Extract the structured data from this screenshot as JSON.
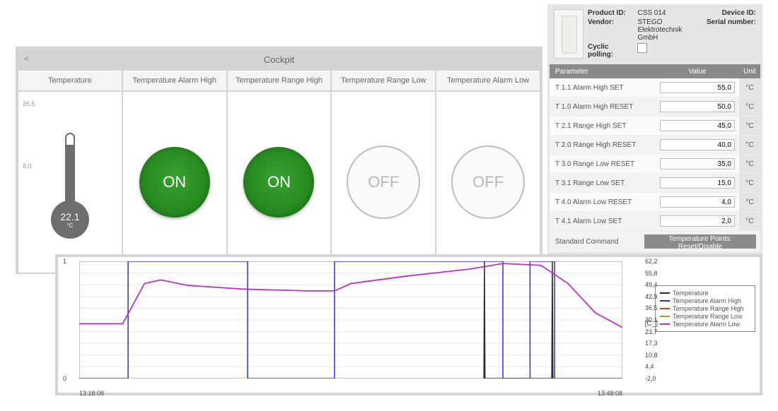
{
  "cockpit": {
    "title": "Cockpit",
    "back_label": "<",
    "columns": [
      {
        "header": "Temperature"
      },
      {
        "header": "Temperature Alarm High"
      },
      {
        "header": "Temperature Range High"
      },
      {
        "header": "Temperature Range Low"
      },
      {
        "header": "Temperature Alarm Low"
      }
    ],
    "thermometer": {
      "scale_top": "26.5",
      "scale_bottom": "8.0",
      "value": "22.1",
      "unit": "°C"
    },
    "indicators": {
      "on_label": "ON",
      "off_label": "OFF",
      "states": [
        "ON",
        "ON",
        "OFF",
        "OFF"
      ]
    }
  },
  "device": {
    "labels": {
      "product_id": "Product ID:",
      "vendor": "Vendor:",
      "cyclic_polling": "Cyclic polling:",
      "device_id": "Device ID:",
      "serial_number": "Serial number:"
    },
    "values": {
      "product_id": "CSS 014",
      "vendor": "STEGO Elektrotechnik GmbH",
      "device_id": "",
      "serial_number": ""
    },
    "cyclic_polling_checked": false,
    "table_head": {
      "parameter": "Parameter",
      "value": "Value",
      "unit": "Unit"
    },
    "rows": [
      {
        "param": "T 1.1 Alarm High SET",
        "value": "55,0",
        "unit": "°C"
      },
      {
        "param": "T 1.0 Alarm High RESET",
        "value": "50,0",
        "unit": "°C"
      },
      {
        "param": "T 2.1 Range High SET",
        "value": "45,0",
        "unit": "°C"
      },
      {
        "param": "T 2.0 Range High RESET",
        "value": "40,0",
        "unit": "°C"
      },
      {
        "param": "T 3.0 Range Low RESET",
        "value": "35,0",
        "unit": "°C"
      },
      {
        "param": "T 3.1 Range Low SET",
        "value": "15,0",
        "unit": "°C"
      },
      {
        "param": "T 4.0 Alarm Low RESET",
        "value": "4,0",
        "unit": "°C"
      },
      {
        "param": "T 4.1 Alarm Low SET",
        "value": "2,0",
        "unit": "°C"
      }
    ],
    "command_row": {
      "label": "Standard Command",
      "button": "Temperature Points: Reset/Disable"
    }
  },
  "chart_data": {
    "type": "line",
    "x_range_labels": [
      "13:18:08",
      "13:48:08"
    ],
    "left_axis": {
      "ticks": [
        "0",
        "1"
      ],
      "label": ""
    },
    "right_axis": {
      "ticks": [
        "-2,0",
        "4,4",
        "10,8",
        "17,3",
        "23,7",
        "30,1",
        "36,5",
        "42,9",
        "49,4",
        "55,8",
        "62,2"
      ],
      "label": "[C_]"
    },
    "legend": [
      {
        "name": "Temperature",
        "color": "#2a2a2a"
      },
      {
        "name": "Temperature Alarm High",
        "color": "#2a2ae0"
      },
      {
        "name": "Temperature Range High",
        "color": "#d43a2a"
      },
      {
        "name": "Temperature Range Low",
        "color": "#8aa032"
      },
      {
        "name": "Temperature Alarm Low",
        "color": "#b733c4"
      }
    ],
    "series": [
      {
        "name": "Alarm High (digital 0/1, left axis)",
        "color": "#2a2ae0",
        "x": [
          0.0,
          0.09,
          0.09,
          0.31,
          0.31,
          0.47,
          0.47,
          0.78,
          0.78,
          0.83,
          0.83,
          0.875,
          0.875,
          1.0
        ],
        "values": [
          0,
          0,
          1,
          1,
          0,
          0,
          1,
          1,
          0,
          0,
          1,
          1,
          0,
          0
        ]
      },
      {
        "name": "Temperature markers (vertical, left axis)",
        "color": "#2a2a2a",
        "x": [
          0.745,
          0.746,
          0.747,
          0.87,
          0.871,
          0.872
        ],
        "values": [
          0,
          1,
          0,
          0,
          1,
          0
        ]
      },
      {
        "name": "Temperature (°C, right axis)",
        "color": "#b733c4",
        "x": [
          0.0,
          0.08,
          0.12,
          0.15,
          0.2,
          0.3,
          0.42,
          0.47,
          0.5,
          0.6,
          0.72,
          0.78,
          0.85,
          0.9,
          0.95,
          1.0
        ],
        "values": [
          28,
          28,
          50,
          52,
          49,
          47,
          46,
          46,
          50,
          54,
          58,
          61,
          60,
          50,
          34,
          26
        ]
      }
    ]
  },
  "legend_labels": {
    "0": "Temperature",
    "1": "Temperature Alarm High",
    "2": "Temperature Range High",
    "3": "Temperature Range Low",
    "4": "Temperature Alarm Low"
  }
}
